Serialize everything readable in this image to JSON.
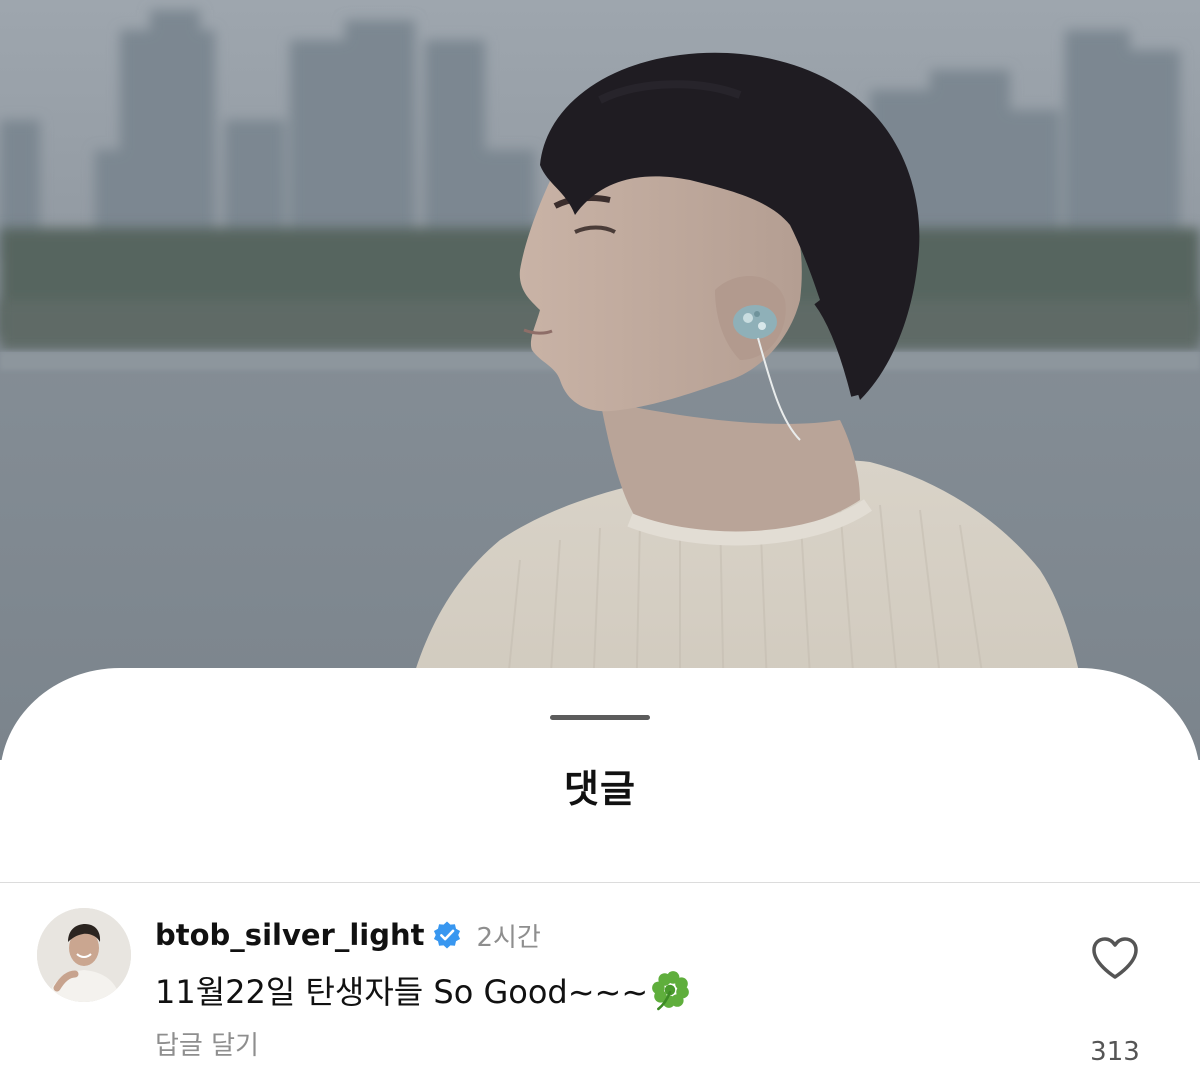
{
  "sheet": {
    "title": "댓글"
  },
  "comment": {
    "username": "btob_silver_light",
    "verified": true,
    "time": "2시간",
    "text": "11월22일 탄생자들 So Good~~~",
    "emoji": "four-leaf-clover",
    "reply_label": "답글 달기",
    "like_count": "313"
  },
  "colors": {
    "verified_badge": "#3897f0",
    "secondary_text": "#8e8e8e",
    "primary_text": "#111111"
  }
}
